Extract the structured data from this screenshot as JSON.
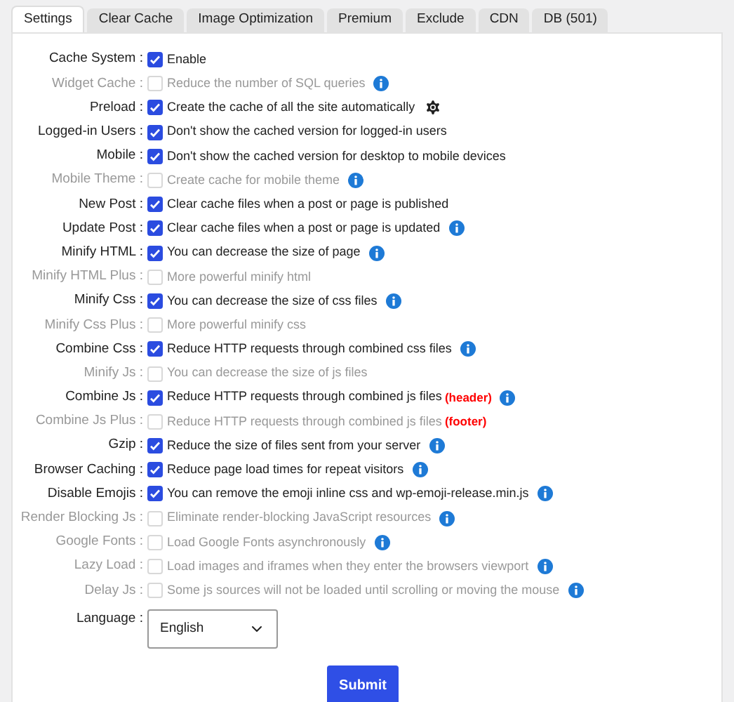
{
  "tabs": [
    {
      "label": "Settings",
      "selected": true
    },
    {
      "label": "Clear Cache",
      "selected": false
    },
    {
      "label": "Image Optimization",
      "selected": false
    },
    {
      "label": "Premium",
      "selected": false
    },
    {
      "label": "Exclude",
      "selected": false
    },
    {
      "label": "CDN",
      "selected": false
    },
    {
      "label": "DB (501)",
      "selected": false
    }
  ],
  "options": [
    {
      "label": "Cache System :",
      "checked": true,
      "description": "Enable",
      "kind": "plain"
    },
    {
      "label": "Widget Cache :",
      "checked": false,
      "description": "Reduce the number of SQL queries",
      "kind": "info"
    },
    {
      "label": "Preload :",
      "checked": true,
      "description": "Create the cache of all the site automatically",
      "kind": "gear"
    },
    {
      "label": "Logged-in Users :",
      "checked": true,
      "description": "Don't show the cached version for logged-in users",
      "kind": "plain"
    },
    {
      "label": "Mobile :",
      "checked": true,
      "description": "Don't show the cached version for desktop to mobile devices",
      "kind": "plain"
    },
    {
      "label": "Mobile Theme :",
      "checked": false,
      "description": "Create cache for mobile theme",
      "kind": "info"
    },
    {
      "label": "New Post :",
      "checked": true,
      "description": "Clear cache files when a post or page is published",
      "kind": "plain"
    },
    {
      "label": "Update Post :",
      "checked": true,
      "description": "Clear cache files when a post or page is updated",
      "kind": "info"
    },
    {
      "label": "Minify HTML :",
      "checked": true,
      "description": "You can decrease the size of page",
      "kind": "info"
    },
    {
      "label": "Minify HTML Plus :",
      "checked": false,
      "description": "More powerful minify html",
      "kind": "plain"
    },
    {
      "label": "Minify Css :",
      "checked": true,
      "description": "You can decrease the size of css files",
      "kind": "info"
    },
    {
      "label": "Minify Css Plus :",
      "checked": false,
      "description": "More powerful minify css",
      "kind": "plain"
    },
    {
      "label": "Combine Css :",
      "checked": true,
      "description": "Reduce HTTP requests through combined css files",
      "kind": "info"
    },
    {
      "label": "Minify Js :",
      "checked": false,
      "description": "You can decrease the size of js files",
      "kind": "plain"
    },
    {
      "label": "Combine Js :",
      "checked": true,
      "description": "Reduce HTTP requests through combined js files",
      "tag": "(header)",
      "kind": "info"
    },
    {
      "label": "Combine Js Plus :",
      "checked": false,
      "description": "Reduce HTTP requests through combined js files",
      "tag": "(footer)",
      "kind": "plain"
    },
    {
      "label": "Gzip :",
      "checked": true,
      "description": "Reduce the size of files sent from your server",
      "kind": "info"
    },
    {
      "label": "Browser Caching :",
      "checked": true,
      "description": "Reduce page load times for repeat visitors",
      "kind": "info"
    },
    {
      "label": "Disable Emojis :",
      "checked": true,
      "description": "You can remove the emoji inline css and wp-emoji-release.min.js",
      "kind": "info"
    },
    {
      "label": "Render Blocking Js :",
      "checked": false,
      "description": "Eliminate render-blocking JavaScript resources",
      "kind": "info"
    },
    {
      "label": "Google Fonts :",
      "checked": false,
      "description": "Load Google Fonts asynchronously",
      "kind": "info"
    },
    {
      "label": "Lazy Load :",
      "checked": false,
      "description": "Load images and iframes when they enter the browsers viewport",
      "kind": "info"
    },
    {
      "label": "Delay Js :",
      "checked": false,
      "description": "Some js sources will not be loaded until scrolling or moving the mouse",
      "kind": "info"
    }
  ],
  "language": {
    "label": "Language :",
    "value": "English"
  },
  "submit": "Submit"
}
